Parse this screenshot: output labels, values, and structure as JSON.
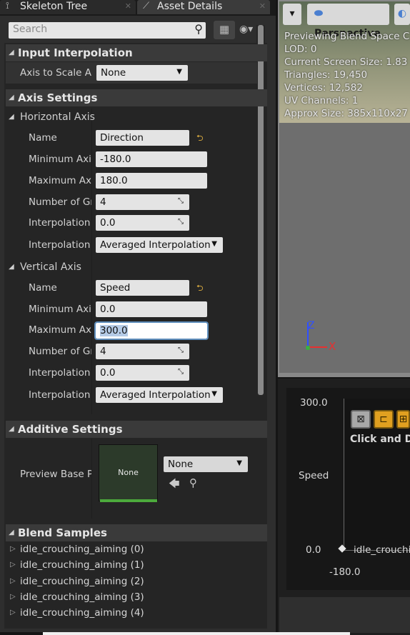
{
  "tabs": [
    {
      "label": "Skeleton Tree",
      "icon": "skeleton-icon"
    },
    {
      "label": "Asset Details",
      "icon": "asset-details-icon"
    }
  ],
  "search": {
    "placeholder": "Search"
  },
  "sections": {
    "input_interpolation": {
      "title": "Input Interpolation",
      "axis_to_scale_label": "Axis to Scale A",
      "axis_to_scale_value": "None"
    },
    "axis_settings": {
      "title": "Axis Settings",
      "horizontal": {
        "title": "Horizontal Axis",
        "name_label": "Name",
        "name_value": "Direction",
        "min_label": "Minimum Axi",
        "min_value": "-180.0",
        "max_label": "Maximum Ax",
        "max_value": "180.0",
        "grid_label": "Number of Gri",
        "grid_value": "4",
        "interp_time_label": "Interpolation",
        "interp_time_value": "0.0",
        "interp_type_label": "Interpolation",
        "interp_type_value": "Averaged Interpolation"
      },
      "vertical": {
        "title": "Vertical Axis",
        "name_label": "Name",
        "name_value": "Speed",
        "min_label": "Minimum Axi",
        "min_value": "0.0",
        "max_label": "Maximum Ax",
        "max_value": "300.0",
        "grid_label": "Number of Gri",
        "grid_value": "4",
        "interp_time_label": "Interpolation",
        "interp_time_value": "0.0",
        "interp_type_label": "Interpolation",
        "interp_type_value": "Averaged Interpolation"
      }
    },
    "additive_settings": {
      "title": "Additive Settings",
      "preview_label": "Preview Base P",
      "thumbnail_text": "None",
      "asset_value": "None"
    },
    "blend_samples": {
      "title": "Blend Samples",
      "items": [
        "idle_crouching_aiming (0)",
        "idle_crouching_aiming (1)",
        "idle_crouching_aiming (2)",
        "idle_crouching_aiming (3)",
        "idle_crouching_aiming (4)"
      ]
    }
  },
  "viewport": {
    "perspective_label": "Perspective",
    "info_lines": [
      "Previewing Blend Space C",
      "LOD: 0",
      "Current Screen Size: 1.83",
      "Triangles: 19,450",
      "Vertices: 12,582",
      "UV Channels: 1",
      "Approx Size: 385x110x27"
    ],
    "axis_z": "Z",
    "axis_x": "X"
  },
  "blendspace": {
    "y_max": "300.0",
    "y_label": "Speed",
    "y_min": "0.0",
    "x_min": "-180.0",
    "hint": "Click and Dr",
    "sample_label": "idle_crouchi"
  }
}
